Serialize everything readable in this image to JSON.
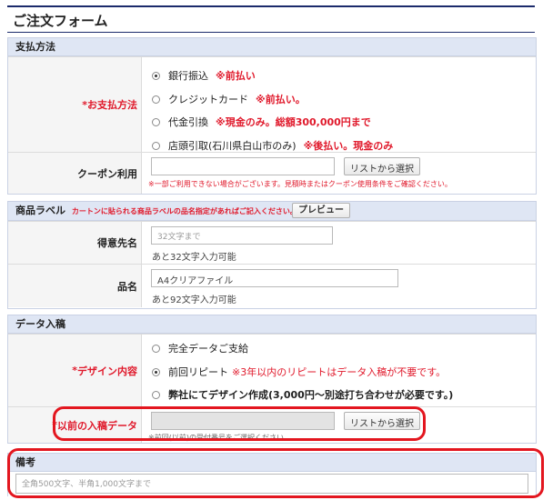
{
  "page_title": "ご注文フォーム",
  "payment": {
    "header": "支払方法",
    "label_required": "*",
    "label": "お支払方法",
    "options": [
      {
        "label": "銀行振込",
        "note": "※前払い",
        "checked": true
      },
      {
        "label": "クレジットカード",
        "note": "※前払い。",
        "checked": false
      },
      {
        "label": "代金引換",
        "note": "※現金のみ。総額300,000円まで",
        "checked": false
      },
      {
        "label": "店頭引取(石川県白山市のみ)",
        "note": "※後払い。現金のみ",
        "checked": false
      }
    ],
    "coupon_label": "クーポン利用",
    "coupon_value": "",
    "coupon_button": "リストから選択",
    "coupon_note": "※一部ご利用できない場合がございます。見積時またはクーポン使用条件をご確認ください。"
  },
  "product_label": {
    "header": "商品ラベル",
    "header_note": "カートンに貼られる商品ラベルの品名指定があればご記入ください。",
    "preview_button": "プレビュー",
    "customer_label": "得意先名",
    "customer_placeholder": "32文字まで",
    "customer_hint": "あと32文字入力可能",
    "item_label": "品名",
    "item_value": "A4クリアファイル",
    "item_hint": "あと92文字入力可能"
  },
  "data_submission": {
    "header": "データ入稿",
    "design_required": "*",
    "design_label": "デザイン内容",
    "options": [
      {
        "label": "完全データご支給",
        "note": "",
        "checked": false
      },
      {
        "label": "前回リピート",
        "note": "※3年以内のリピートはデータ入稿が不要です。",
        "checked": true
      },
      {
        "label": "弊社にてデザイン作成(3,000円～別途打ち合わせが必要です。)",
        "note": "",
        "checked": false
      }
    ],
    "previous_required": "*",
    "previous_label": "以前の入稿データ",
    "previous_value": "",
    "previous_button": "リストから選択",
    "previous_note": "※前回(以前)の受付番号をご選択ください。"
  },
  "remarks": {
    "header": "備考",
    "placeholder": "全角500文字、半角1,000文字まで"
  },
  "colors": {
    "accent_red": "#e0192b",
    "highlight_red": "#e3161f",
    "header_bg": "#dfe6f4",
    "title_rule": "#1b2a6b"
  }
}
